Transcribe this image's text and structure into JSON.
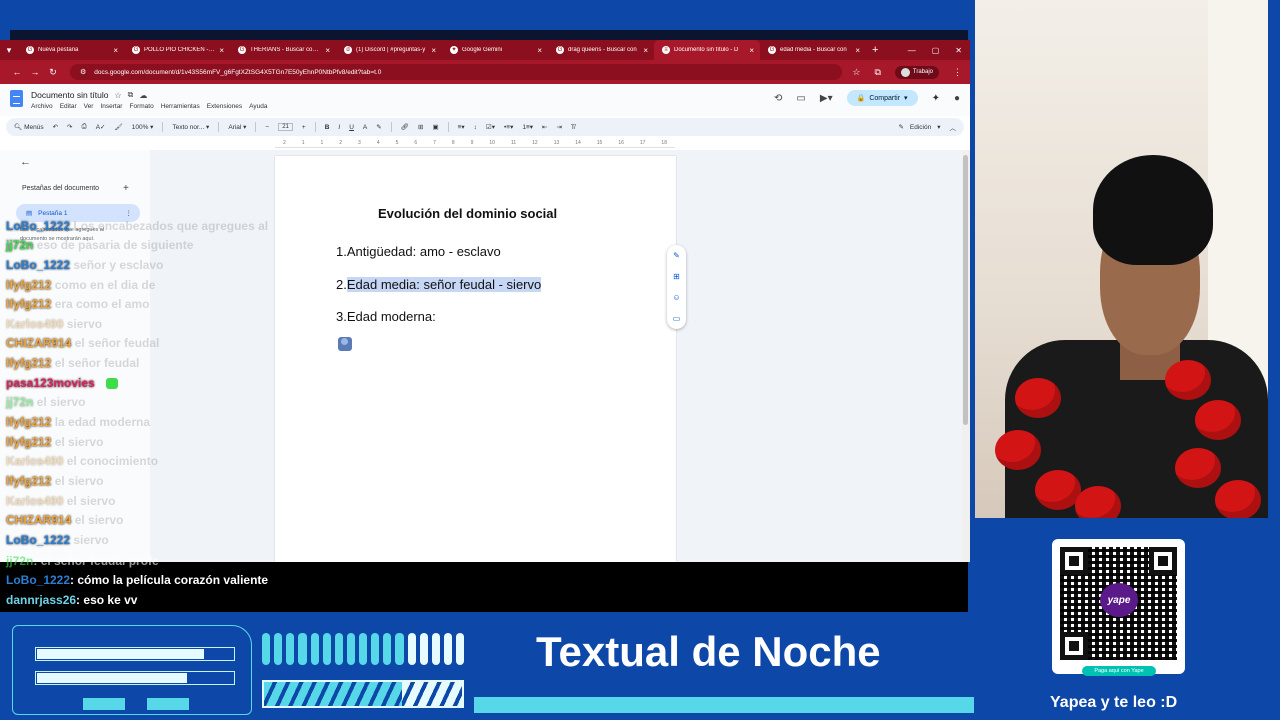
{
  "browser": {
    "tabs": [
      {
        "title": "Nueva pestaña",
        "active": false
      },
      {
        "title": "POLLO PIO CHICKEN - Bu",
        "active": false
      },
      {
        "title": "THERIANS - Buscar con G",
        "active": false
      },
      {
        "title": "(1) Discord | #preguntas-y",
        "active": false
      },
      {
        "title": "Google Gemini",
        "active": false
      },
      {
        "title": "drag queens - Buscar con",
        "active": false
      },
      {
        "title": "Documento sin título - D",
        "active": true
      },
      {
        "title": "edad media - Buscar con",
        "active": false
      }
    ],
    "url": "docs.google.com/document/d/1v43S56mFV_g6FgtXZtSG4X5TGn7E50yEhnP0NtbPfv8/edit?tab=t.0",
    "profile": "Trabajo"
  },
  "docs": {
    "title": "Documento sin título",
    "menu": [
      "Archivo",
      "Editar",
      "Ver",
      "Insertar",
      "Formato",
      "Herramientas",
      "Extensiones",
      "Ayuda"
    ],
    "share_label": "Compartir",
    "toolbar": {
      "menus": "Menús",
      "zoom": "100%",
      "style": "Texto nor...",
      "font": "Arial",
      "size": "21",
      "mode": "Edición"
    },
    "ruler": [
      "2",
      "1",
      "1",
      "2",
      "3",
      "4",
      "5",
      "6",
      "7",
      "8",
      "9",
      "10",
      "11",
      "12",
      "13",
      "14",
      "15",
      "16",
      "17",
      "18"
    ],
    "sidebar": {
      "heading": "Pestañas del documento",
      "tab": "Pestaña 1",
      "note": "Los encabezados que agregues al documento se mostrarán aquí."
    },
    "content": {
      "heading": "Evolución del dominio social",
      "items": [
        "1.Antigüedad: amo - esclavo",
        "2.",
        "Edad media: señor feudal - siervo",
        "3.Edad moderna:"
      ]
    }
  },
  "chat": [
    {
      "user": "LoBo_1222",
      "color": "#2a7fd4",
      "msg": "Los encabezados que agregues al"
    },
    {
      "user": "jj72n",
      "color": "#3ddc4a",
      "msg": "eso de pasaria de siguiente"
    },
    {
      "user": "LoBo_1222",
      "color": "#2a7fd4",
      "msg": "señor y esclavo"
    },
    {
      "user": "lfyfg212",
      "color": "#f0a43a",
      "msg": "como en el dia de"
    },
    {
      "user": "lfyfg212",
      "color": "#f0a43a",
      "msg": "era como el amo"
    },
    {
      "user": "Karlos490",
      "color": "#e6a23c",
      "msg": "siervo"
    },
    {
      "user": "CHIZAR914",
      "color": "#f0a43a",
      "msg": "el señor feudal"
    },
    {
      "user": "lfyfg212",
      "color": "#f0a43a",
      "msg": "el señor feudal"
    },
    {
      "user": "pasa123movies",
      "color": "#e0205a",
      "msg": ""
    },
    {
      "user": "jj72n",
      "color": "#3ddc4a",
      "msg": "el siervo"
    },
    {
      "user": "lfyfg212",
      "color": "#f0a43a",
      "msg": "la edad moderna"
    },
    {
      "user": "lfyfg212",
      "color": "#f0a43a",
      "msg": "el siervo"
    },
    {
      "user": "Karlos490",
      "color": "#e6a23c",
      "msg": "el conocimiento"
    },
    {
      "user": "lfyfg212",
      "color": "#f0a43a",
      "msg": "el siervo"
    },
    {
      "user": "Karlos490",
      "color": "#e6a23c",
      "msg": "el siervo"
    },
    {
      "user": "CHIZAR914",
      "color": "#f0a43a",
      "msg": "el siervo"
    },
    {
      "user": "LoBo_1222",
      "color": "#2a7fd4",
      "msg": "siervo"
    }
  ],
  "chat_bar": [
    {
      "user": "jj72n",
      "color": "#3ddc4a",
      "msg": "el señor feudal profe"
    },
    {
      "user": "LoBo_1222",
      "color": "#2a7fd4",
      "msg": "cómo la película corazón valiente"
    },
    {
      "user": "dannrjass26",
      "color": "#6fd3e8",
      "msg": "eso ke vv"
    }
  ],
  "stream": {
    "title": "Textual de Noche",
    "qr_logo": "yape",
    "qr_caption": "Paga aquí con Yape",
    "tagline": "Yapea y te leo :D"
  }
}
